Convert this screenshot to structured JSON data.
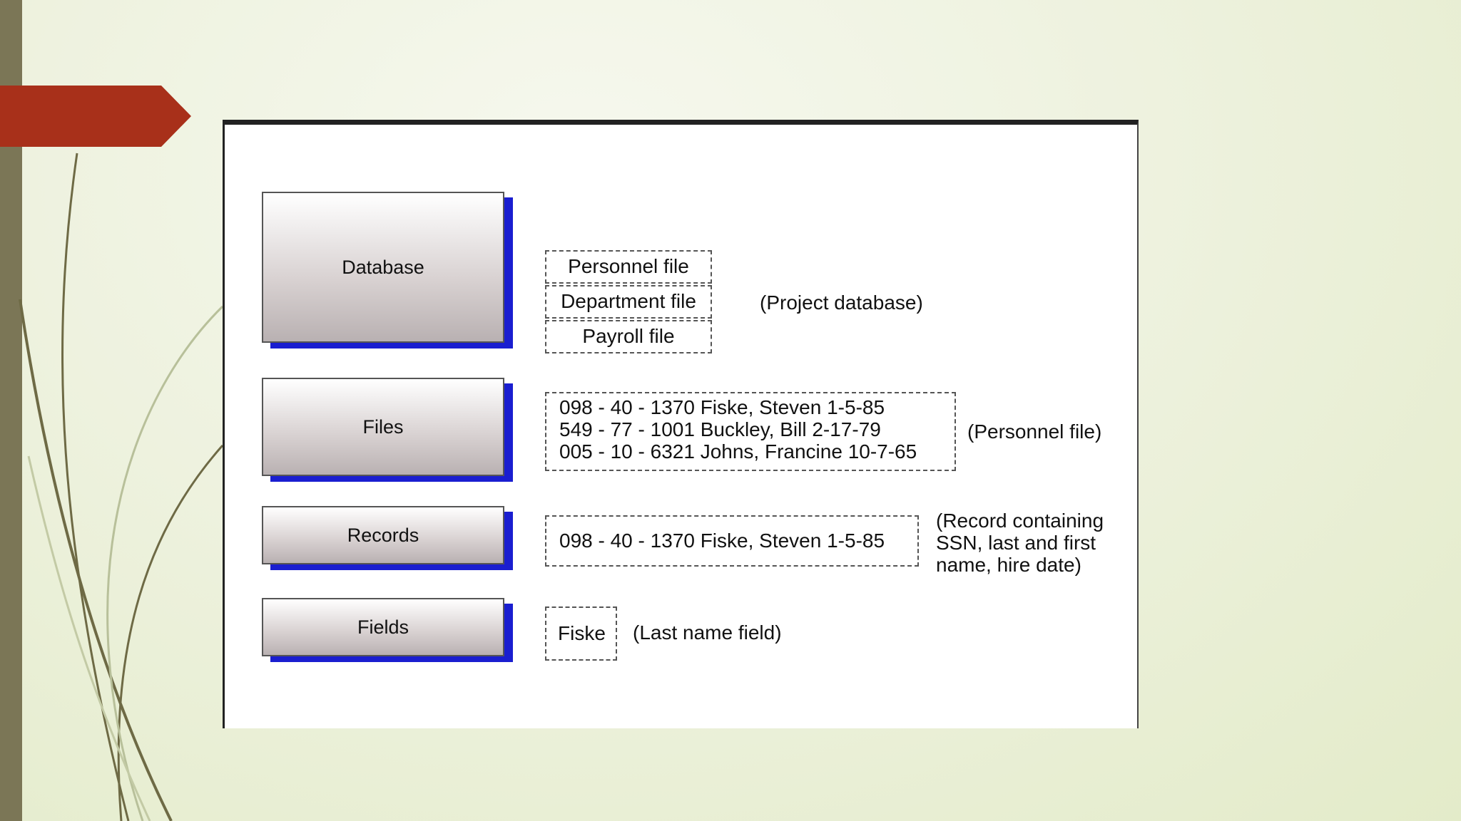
{
  "diagram": {
    "levels": [
      {
        "label": "Database"
      },
      {
        "label": "Files"
      },
      {
        "label": "Records"
      },
      {
        "label": "Fields"
      }
    ],
    "database_files": [
      "Personnel file",
      "Department file",
      "Payroll file"
    ],
    "database_note": "(Project database)",
    "file_records": [
      "098 - 40 - 1370 Fiske, Steven 1-5-85",
      "549 - 77 - 1001 Buckley, Bill 2-17-79",
      "005 - 10 - 6321 Johns, Francine 10-7-65"
    ],
    "file_note": "(Personnel file)",
    "record_example": "098 - 40 - 1370 Fiske, Steven 1-5-85",
    "record_note_lines": [
      "(Record containing",
      "SSN, last and first",
      "name, hire date)"
    ],
    "field_example": "Fiske",
    "field_note": "(Last name field)"
  },
  "theme": {
    "accent": "#a8301a",
    "sidebar": "#7b7656",
    "box_shadow": "#1a1ed0"
  }
}
